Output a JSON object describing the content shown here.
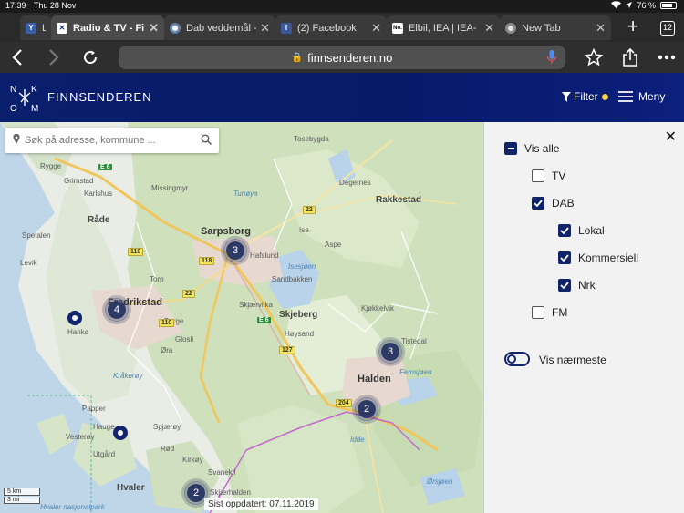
{
  "status": {
    "time": "17:39",
    "date": "Thu 28 Nov",
    "battery": "76 %",
    "battery_level": 0.76
  },
  "tabs": [
    {
      "label": "Ly",
      "favicon": "Y",
      "fav_color": "#3a5ea8"
    },
    {
      "label": "Radio & TV - Fi",
      "favicon": "✕",
      "fav_color": "#ffffff",
      "active": true
    },
    {
      "label": "Dab veddemål -",
      "favicon": "◉",
      "fav_color": "#5b7fa8"
    },
    {
      "label": "(2) Facebook",
      "favicon": "f",
      "fav_color": "#3b5998"
    },
    {
      "label": "Elbil, IEA | IEA-",
      "favicon": "No.",
      "fav_color": "#ffffff"
    },
    {
      "label": "New Tab",
      "favicon": "🌐",
      "fav_color": "#888888"
    }
  ],
  "tab_count": "12",
  "url": "finnsenderen.no",
  "site": {
    "brand": "FINNSENDEREN",
    "filter_label": "Filter",
    "menu_label": "Meny"
  },
  "search": {
    "placeholder": "Søk på adresse, kommune ..."
  },
  "map": {
    "clusters": [
      "3",
      "4",
      "3",
      "2",
      "2"
    ],
    "places": {
      "sarpsborg": "Sarpsborg",
      "fredrikstad": "Fredrikstad",
      "halden": "Halden",
      "skjeberg": "Skjeberg",
      "rakkestad": "Rakkestad",
      "rade": "Råde",
      "rygge": "Rygge",
      "hvaler": "Hvaler",
      "vesteroy": "Vesterøy",
      "hanko": "Hankø",
      "spetalen": "Spetalen",
      "levik": "Levik",
      "grimstad": "Grimstad",
      "karlshus": "Karlshus",
      "tune": "Tunøya",
      "isesjoen": "Isesjøen",
      "femsjoen": "Femsjøen",
      "idde": "Idde",
      "orsjoen": "Ørsjøen",
      "skipstad": "Kjøkkelvik",
      "hafslund": "Hafslund",
      "aspe": "Aspe",
      "krakeroy": "Kråkerøy",
      "glosli": "Glosli",
      "borge": "Borge",
      "sandbakken": "Sandbakken",
      "tosebygda": "Tosebygda",
      "degernes": "Degernes",
      "ise": "Ise",
      "skjeberg_kirke": "Skjærviika",
      "hoysand": "Høysand",
      "ora": "Øra",
      "torp": "Torp",
      "utgard": "Utgård",
      "papper": "Papper",
      "hauge": "Hauge",
      "kirkoy": "Kirkøy",
      "svanekil": "Svanekil",
      "skjaehalden": "Skjærhalden",
      "hvaler_np": "Hvaler nasjonalpark",
      "spjaerøy": "Spjærøy",
      "rod": "Rød",
      "mossemarka": "Missingmyr",
      "halden_tistedal": "Tistedal"
    },
    "roads": [
      "E 6",
      "110",
      "22",
      "118",
      "127",
      "204",
      "E 6",
      "22",
      "110"
    ],
    "scale": [
      "5 km",
      "3 mi"
    ],
    "updated": "Sist oppdatert: 07.11.2019"
  },
  "panel": {
    "options": [
      {
        "label": "Vis alle",
        "state": "partial"
      },
      {
        "label": "TV",
        "state": "off"
      },
      {
        "label": "DAB",
        "state": "on"
      },
      {
        "label": "Lokal",
        "state": "on"
      },
      {
        "label": "Kommersiell",
        "state": "on"
      },
      {
        "label": "Nrk",
        "state": "on"
      },
      {
        "label": "FM",
        "state": "off"
      }
    ],
    "toggle_label": "Vis nærmeste"
  },
  "colors": {
    "brand": "#0a1e6e",
    "accent": "#f3d23b",
    "cluster": "#2e3a66"
  }
}
